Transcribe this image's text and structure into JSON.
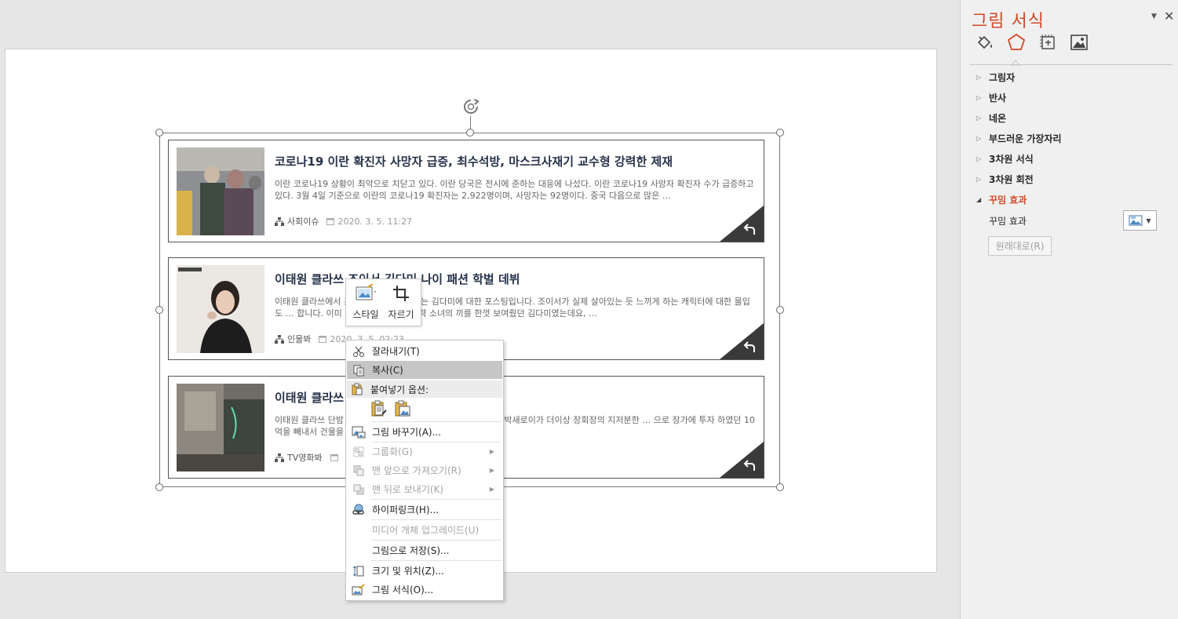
{
  "cards": [
    {
      "title": "코로나19 이란 확진자 사망자 급증, 최수석방, 마스크사재기 교수형 강력한 제재",
      "desc": "이란 코로나19 상황이 최악으로 치닫고 있다. 이란 당국은 전시에 준하는 대응에 나섰다. 이란 코로나19 사망자 확진자 수가 급증하고 있다. 3월 4일 기준으로 이란의 코로나19 확진자는 2,922명이며, 사망자는 92명이다. 중국 다음으로 많은 …",
      "category": "사회이슈",
      "date": "2020. 3. 5. 11:27"
    },
    {
      "title": "이태원 클라쓰 조이서 김다미 나이 패션 학벌 데뷔",
      "desc": "이태원 클라쓰에서 조이서 역으로 선보이는 김다미에 대한 포스팅입니다. 조이서가 실제 살아있는 듯 느끼게 하는 캐릭터에 대한 몰입도 … 합니다. 이미 영화 '마녀'에서 초능력 소녀의 끼를 한껏 보여줬던 김다미였는데요, …",
      "category": "인물봐",
      "date": "2020. 3. 5. 02:23"
    },
    {
      "title": "이태원 클라쓰 … 경리단길이 아니면 어디?",
      "desc": "이태원 클라쓰 단밤 … 에 있는 것으로 나온다. 드라마 상에서는 박새로이가 더이상 장회장의 지저분한 … 으로 장가에 투자 하였던 10억을 빼내서 건물을 아예 사들이는…",
      "category": "TV영화봐",
      "date": ""
    }
  ],
  "minitoolbar": {
    "style_label": "스타일",
    "crop_label": "자르기"
  },
  "context_menu": {
    "cut": "잘라내기(T)",
    "copy": "복사(C)",
    "paste_header": "붙여넣기 옵션:",
    "change_picture": "그림 바꾸기(A)...",
    "group": "그룹화(G)",
    "bring_front": "맨 앞으로 가져오기(R)",
    "send_back": "맨 뒤로 보내기(K)",
    "hyperlink": "하이퍼링크(H)...",
    "media_update": "미디어 개체 업그레이드(U)",
    "save_as_picture": "그림으로 저장(S)...",
    "size_position": "크기 및 위치(Z)...",
    "format_picture": "그림 서식(O)..."
  },
  "pane": {
    "title": "그림 서식",
    "sections": [
      "그림자",
      "반사",
      "네온",
      "부드러운 가장자리",
      "3차원 서식",
      "3차원 회전",
      "꾸밈 효과"
    ],
    "open_section_item_label": "꾸밈 효과",
    "reset_label": "원래대로(R)",
    "accent_color": "#d24726"
  }
}
